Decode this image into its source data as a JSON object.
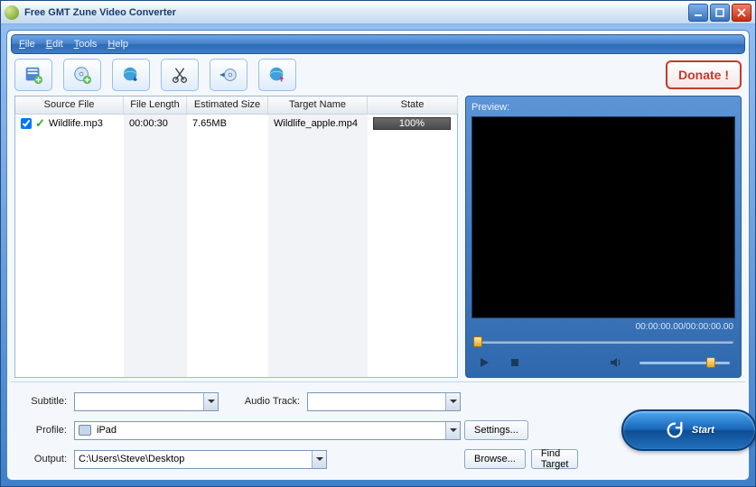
{
  "window": {
    "title": "Free GMT Zune Video Converter"
  },
  "menu": {
    "file": "File",
    "edit": "Edit",
    "tools": "Tools",
    "help": "Help"
  },
  "toolbar": {
    "donate": "Donate !"
  },
  "columns": {
    "source": "Source File",
    "length": "File Length",
    "size": "Estimated Size",
    "target": "Target Name",
    "state": "State"
  },
  "rows": [
    {
      "checked": true,
      "status_ok": true,
      "source": "Wildlife.mp3",
      "length": "00:00:30",
      "size": "7.65MB",
      "target": "Wildlife_apple.mp4",
      "state": "100%"
    }
  ],
  "preview": {
    "label": "Preview:",
    "time": "00:00:00.00/00:00:00.00"
  },
  "form": {
    "subtitle_label": "Subtitle:",
    "audiotrack_label": "Audio Track:",
    "profile_label": "Profile:",
    "profile_value": "iPad",
    "output_label": "Output:",
    "output_value": "C:\\Users\\Steve\\Desktop",
    "settings": "Settings...",
    "browse": "Browse...",
    "findtarget": "Find Target",
    "start": "Start"
  }
}
